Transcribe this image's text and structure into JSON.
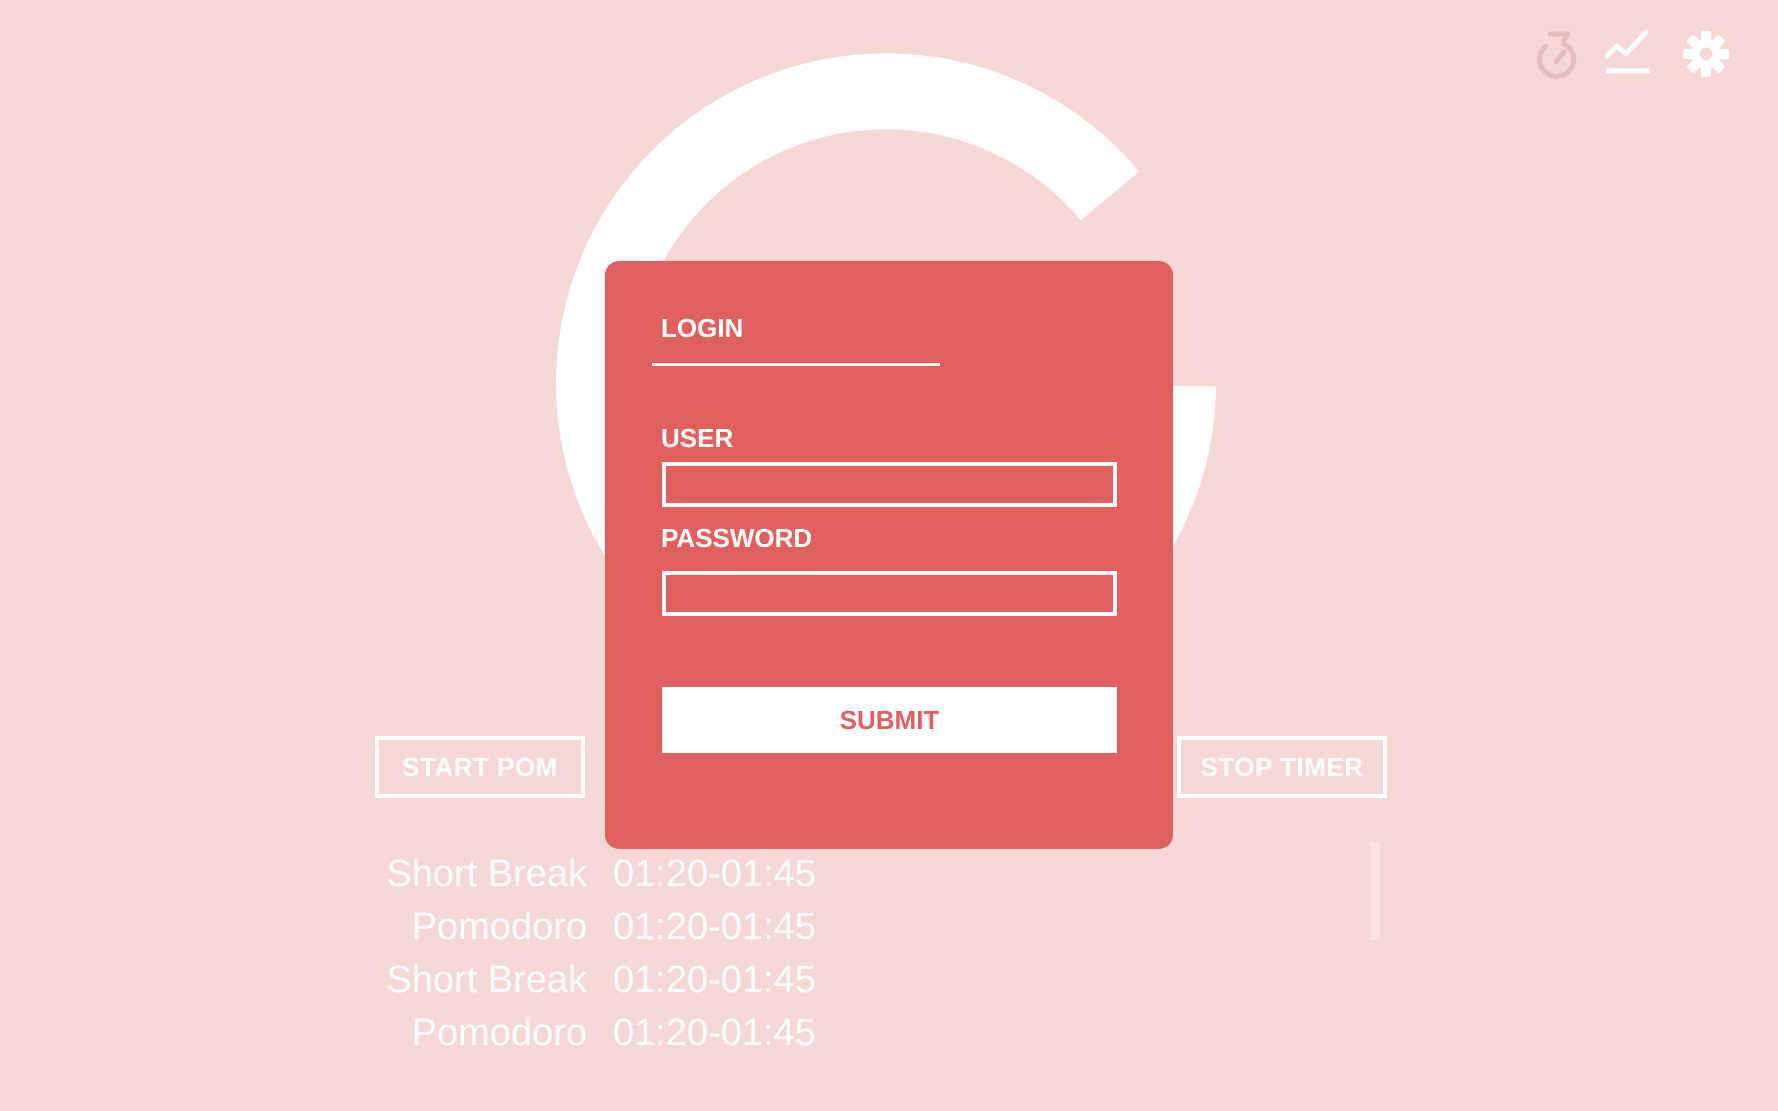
{
  "toolbar": {
    "icons": [
      "timer-icon",
      "stats-chart-icon",
      "gear-icon"
    ]
  },
  "controls": {
    "start_label": "START POM",
    "stop_label": "STOP TIMER"
  },
  "history": [
    {
      "type": "Short Break",
      "time": "01:20-01:45"
    },
    {
      "type": "Pomodoro",
      "time": "01:20-01:45"
    },
    {
      "type": "Short Break",
      "time": "01:20-01:45"
    },
    {
      "type": "Pomodoro",
      "time": "01:20-01:45"
    }
  ],
  "login": {
    "title": "LOGIN",
    "user_label": "USER",
    "user_value": "",
    "password_label": "PASSWORD",
    "password_value": "",
    "submit_label": "SUBMIT"
  },
  "colors": {
    "background": "#F5D7D6",
    "modal": "#E05F5F",
    "text_light": "#FFFFFF",
    "icon_muted": "#E2BDBC"
  }
}
